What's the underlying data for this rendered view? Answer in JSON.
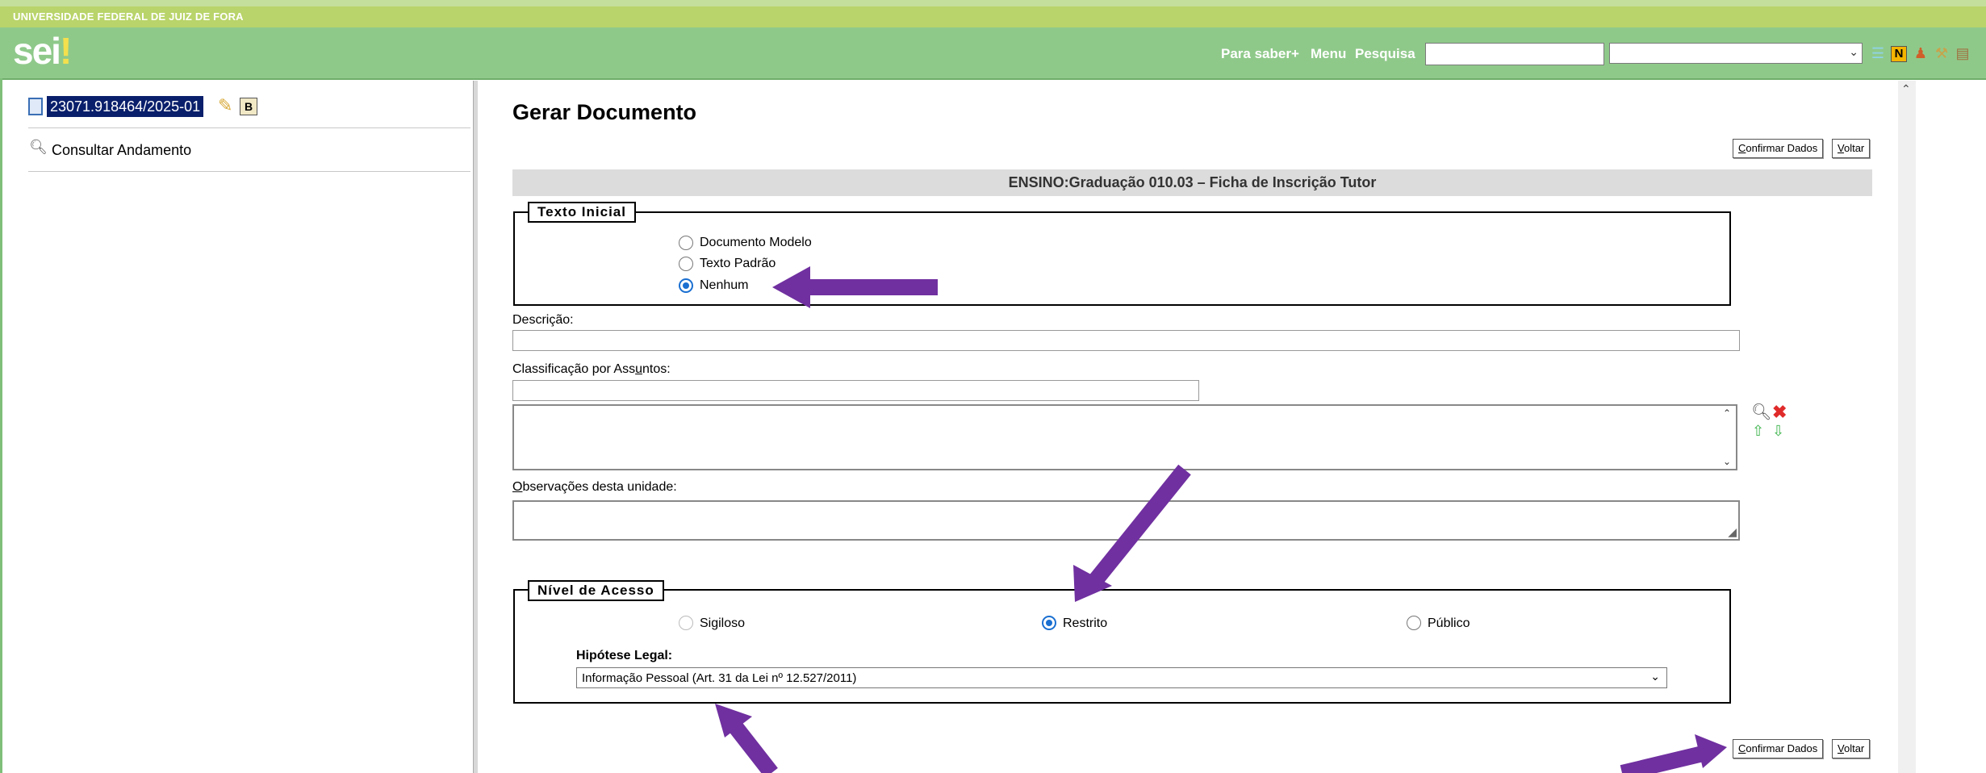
{
  "header": {
    "university": "UNIVERSIDADE FEDERAL DE JUIZ DE FORA",
    "logo_text": "sei",
    "logo_mark": "!",
    "nav": [
      "Para saber+",
      "Menu",
      "Pesquisa"
    ],
    "search_value": "",
    "unit_select_value": "",
    "toolbar_icons": [
      "lines-icon",
      "notes-n-icon",
      "user-icon",
      "tools-icon",
      "exit-icon"
    ]
  },
  "sidebar": {
    "process_number": "23071.918464/2025-01",
    "badge": "B",
    "consult_label": "Consultar Andamento"
  },
  "form": {
    "title": "Gerar Documento",
    "confirm_label_u": "C",
    "confirm_label_rest": "onfirmar Dados",
    "back_label_u": "V",
    "back_label_rest": "oltar",
    "doc_type": "ENSINO:Graduação 010.03 – Ficha de Inscrição Tutor",
    "texto_inicial": {
      "legend": "Texto Inicial",
      "options": [
        "Documento Modelo",
        "Texto Padrão",
        "Nenhum"
      ],
      "selected": "Nenhum"
    },
    "descricao_label": "Descrição:",
    "descricao_value": "",
    "classificacao_label_pre": "Classificação por Ass",
    "classificacao_label_u": "u",
    "classificacao_label_post": "ntos:",
    "observacoes_label_u": "O",
    "observacoes_label_rest": "bservações desta unidade:",
    "nivel_acesso": {
      "legend": "Nível de Acesso",
      "options": [
        "Sigiloso",
        "Restrito",
        "Público"
      ],
      "selected": "Restrito"
    },
    "hipotese_label": "Hipótese Legal:",
    "hipotese_value": "Informação Pessoal (Art. 31 da Lei nº 12.527/2011)"
  },
  "colors": {
    "header_green": "#8fc98a",
    "uni_bar": "#b9d46a",
    "annotation_arrow": "#7030a0",
    "radio_accent": "#1a6fd1"
  }
}
